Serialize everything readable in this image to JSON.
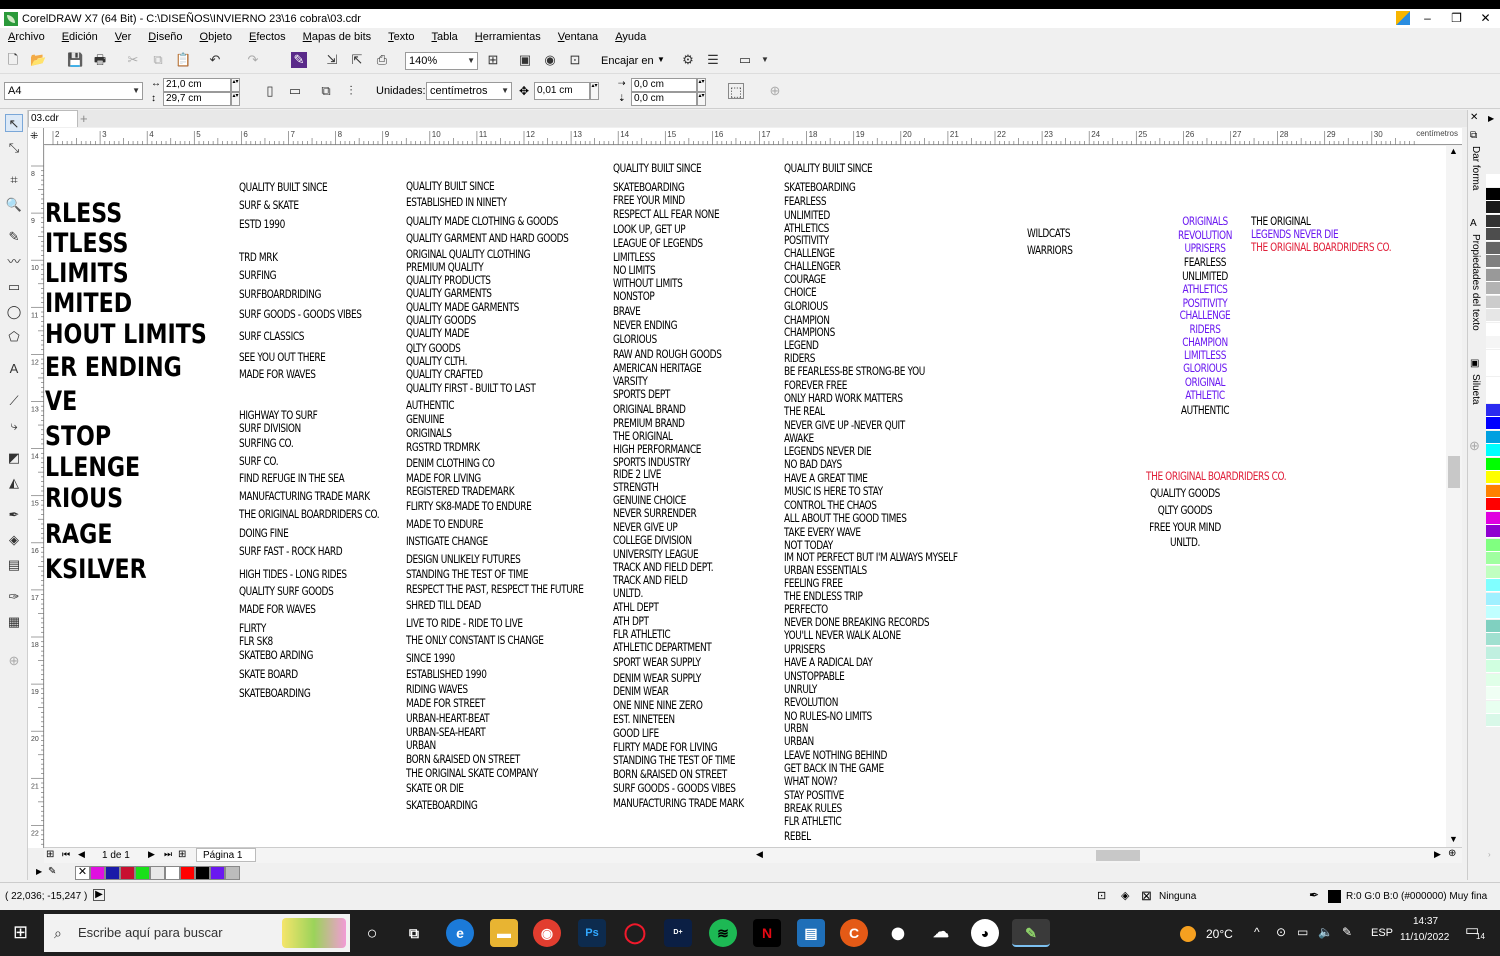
{
  "window": {
    "title": "CorelDRAW X7 (64 Bit) - C:\\DISEÑOS\\INVIERNO 23\\16 cobra\\03.cdr",
    "controls": [
      "–",
      "❐",
      "✕"
    ]
  },
  "menu": [
    "Archivo",
    "Edición",
    "Ver",
    "Diseño",
    "Objeto",
    "Efectos",
    "Mapas de bits",
    "Texto",
    "Tabla",
    "Herramientas",
    "Ventana",
    "Ayuda"
  ],
  "toolbar": {
    "zoom": "140%",
    "snap_label": "Encajar en"
  },
  "props": {
    "page_size": "A4",
    "width": "21,0 cm",
    "height": "29,7 cm",
    "units_label": "Unidades:",
    "units_value": "centímetros",
    "nudge": "0,01 cm",
    "dup_x": "0,0 cm",
    "dup_y": "0,0 cm"
  },
  "doc_tab": "03.cdr",
  "ruler": {
    "labels": [
      "2",
      "3",
      "4",
      "5",
      "6",
      "7",
      "8",
      "9",
      "10",
      "11",
      "12",
      "13",
      "14",
      "15",
      "16",
      "17",
      "18",
      "19",
      "20",
      "21",
      "22",
      "23",
      "24",
      "25",
      "26",
      "27",
      "28",
      "29",
      "30"
    ],
    "unit": "centímetros",
    "v_labels": [
      "8",
      "9",
      "10",
      "11",
      "12",
      "13",
      "14",
      "15",
      "16",
      "17",
      "18",
      "19",
      "20",
      "21",
      "22"
    ]
  },
  "canvas": {
    "col_big": [
      "RLESS",
      "ITLESS",
      "LIMITS",
      "IMITED",
      "HOUT LIMITS",
      "ER ENDING",
      "VE",
      "STOP",
      "LLENGE",
      "RIOUS",
      "RAGE",
      "KSILVER"
    ],
    "col1": [
      "QUALITY BUILT SINCE",
      "SURF & SKATE",
      "ESTD 1990",
      "TRD MRK",
      "SURFING",
      "SURFBOARDRIDING",
      "SURF GOODS - GOODS VIBES",
      "SURF CLASSICS",
      "SEE YOU OUT THERE",
      "MADE FOR WAVES",
      "HIGHWAY TO SURF",
      "SURF DIVISION",
      "SURFING CO.",
      "SURF CO.",
      "FIND REFUGE IN THE SEA",
      "MANUFACTURING TRADE MARK",
      "THE ORIGINAL BOARDRIDERS CO.",
      "DOING FINE",
      "SURF FAST - ROCK HARD",
      "HIGH TIDES - LONG RIDES",
      "QUALITY SURF GOODS",
      "MADE FOR WAVES",
      "FLIRTY",
      "FLR SK8",
      "SKATEBO ARDING",
      "SKATE BOARD",
      "SKATEBOARDING"
    ],
    "col2": [
      "QUALITY BUILT SINCE",
      "ESTABLISHED IN NINETY",
      "QUALITY MADE CLOTHING & GOODS",
      "QUALITY GARMENT AND HARD GOODS",
      "ORIGINAL QUALITY CLOTHING",
      "PREMIUM QUALITY",
      "QUALITY PRODUCTS",
      "QUALITY GARMENTS",
      "QUALITY MADE GARMENTS",
      "QUALITY GOODS",
      "QUALITY MADE",
      "QLTY GOODS",
      "QUALITY CLTH.",
      "QUALITY CRAFTED",
      "QUALITY FIRST - BUILT TO LAST",
      "AUTHENTIC",
      "GENUINE",
      "ORIGINALS",
      "RGSTRD TRDMRK",
      "DENIM CLOTHING CO",
      "MADE FOR LIVING",
      "REGISTERED TRADEMARK",
      "FLIRTY SK8-MADE TO ENDURE",
      "MADE TO ENDURE",
      "INSTIGATE CHANGE",
      "DESIGN UNLIKELY FUTURES",
      "STANDING THE TEST OF TIME",
      "RESPECT THE PAST, RESPECT THE FUTURE",
      "SHRED TILL DEAD",
      "LIVE TO RIDE - RIDE TO LIVE",
      "THE ONLY CONSTANT IS CHANGE",
      "SINCE 1990",
      "ESTABLISHED 1990",
      "RIDING WAVES",
      "MADE FOR STREET",
      "URBAN-HEART-BEAT",
      "URBAN-SEA-HEART",
      "URBAN",
      "BORN &RAISED ON STREET",
      "THE ORIGINAL SKATE COMPANY",
      "SKATE OR DIE",
      "SKATEBOARDING"
    ],
    "col3": [
      "QUALITY BUILT SINCE",
      "SKATEBOARDING",
      "FREE YOUR MIND",
      "RESPECT ALL FEAR NONE",
      "LOOK UP, GET UP",
      "LEAGUE OF LEGENDS",
      "LIMITLESS",
      "NO LIMITS",
      "WITHOUT LIMITS",
      "NONSTOP",
      "BRAVE",
      "NEVER ENDING",
      "GLORIOUS",
      "RAW AND ROUGH GOODS",
      "AMERICAN HERITAGE",
      "VARSITY",
      "SPORTS DEPT",
      "ORIGINAL BRAND",
      "PREMIUM BRAND",
      "THE ORIGINAL",
      "HIGH PERFORMANCE",
      "SPORTS INDUSTRY",
      "RIDE 2 LIVE",
      "STRENGTH",
      "GENUINE CHOICE",
      "NEVER SURRENDER",
      "NEVER GIVE UP",
      "COLLEGE DIVISION",
      "UNIVERSITY LEAGUE",
      "TRACK AND FIELD DEPT.",
      "TRACK AND FIELD",
      "UNLTD.",
      "ATHL DEPT",
      "ATH DPT",
      "FLR ATHLETIC",
      "ATHLETIC DEPARTMENT",
      "SPORT WEAR SUPPLY",
      "DENIM WEAR SUPPLY",
      "DENIM WEAR",
      "ONE NINE NINE ZERO",
      "EST. NINETEEN",
      "GOOD LIFE",
      "FLIRTY MADE FOR LIVING",
      "STANDING THE TEST OF TIME",
      "BORN &RAISED ON STREET",
      "SURF GOODS - GOODS VIBES",
      "MANUFACTURING TRADE MARK"
    ],
    "col4": [
      "QUALITY BUILT SINCE",
      "SKATEBOARDING",
      "FEARLESS",
      "UNLIMITED",
      "ATHLETICS",
      "POSITIVITY",
      "CHALLENGE",
      "CHALLENGER",
      "COURAGE",
      "CHOICE",
      "GLORIOUS",
      "CHAMPION",
      "CHAMPIONS",
      "LEGEND",
      "RIDERS",
      "BE FEARLESS-BE STRONG-BE YOU",
      "FOREVER FREE",
      "ONLY HARD WORK MATTERS",
      "THE REAL",
      "NEVER GIVE UP -NEVER QUIT",
      "AWAKE",
      "LEGENDS NEVER DIE",
      "NO BAD DAYS",
      "HAVE A GREAT TIME",
      "MUSIC IS HERE TO STAY",
      "CONTROL THE CHAOS",
      "ALL ABOUT THE GOOD TIMES",
      "TAKE EVERY WAVE",
      "NOT TODAY",
      "IM NOT PERFECT BUT I'M ALWAYS MYSELF",
      "URBAN ESSENTIALS",
      "FEELING FREE",
      "THE ENDLESS TRIP",
      "PERFECTO",
      "NEVER DONE BREAKING RECORDS",
      "YOU'LL NEVER WALK ALONE",
      "UPRISERS",
      "HAVE A RADICAL DAY",
      "UNSTOPPABLE",
      "UNRULY",
      "REVOLUTION",
      "NO RULES-NO LIMITS",
      "URBN",
      "URBAN",
      "LEAVE NOTHING BEHIND",
      "GET BACK IN THE GAME",
      "WHAT NOW?",
      "STAY POSITIVE",
      "BREAK RULES",
      "FLR ATHLETIC",
      "REBEL"
    ],
    "col5": [
      "WILDCATS",
      "WARRIORS"
    ],
    "col6": [
      "ORIGINALS",
      "REVOLUTION",
      "UPRISERS",
      "FEARLESS",
      "UNLIMITED",
      "ATHLETICS",
      "POSITIVITY",
      "CHALLENGE",
      "RIDERS",
      "CHAMPION",
      "LIMITLESS",
      "GLORIOUS",
      "ORIGINAL",
      "ATHLETIC",
      "AUTHENTIC"
    ],
    "col7": [
      "THE ORIGINAL",
      "LEGENDS NEVER DIE",
      "THE ORIGINAL BOARDRIDERS CO."
    ],
    "col8": [
      "THE ORIGINAL BOARDRIDERS CO.",
      "QUALITY GOODS",
      "QLTY GOODS",
      "FREE YOUR MIND",
      "UNLTD."
    ]
  },
  "colors": {
    "black": "#000000",
    "purple": "#6a18f0",
    "red": "#e0203a"
  },
  "dockers": [
    "Dar forma",
    "Propiedades del texto",
    "Silueta"
  ],
  "pager": {
    "count": "1 de 1",
    "page_tab": "Página 1"
  },
  "status": {
    "coords": "( 22,036; -15,247 )",
    "fill": "Ninguna",
    "outline": "R:0 G:0 B:0 (#000000) Muy fina"
  },
  "taskbar": {
    "search_placeholder": "Escribe aquí para buscar",
    "weather": "20°C",
    "lang": "ESP",
    "time": "14:37",
    "date": "11/10/2022",
    "notif": "14"
  }
}
